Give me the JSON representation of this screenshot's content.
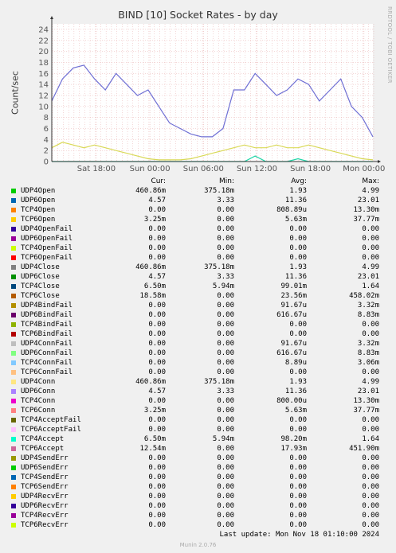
{
  "chart_data": {
    "type": "line",
    "title": "BIND [10] Socket Rates - by day",
    "ylabel": "Count/sec",
    "xlabel": "",
    "ylim": [
      0,
      25
    ],
    "yticks": [
      0,
      2,
      4,
      6,
      8,
      10,
      12,
      14,
      16,
      18,
      20,
      22,
      24
    ],
    "xticks": [
      "Sat 18:00",
      "Sun 00:00",
      "Sun 06:00",
      "Sun 12:00",
      "Sun 18:00",
      "Mon 00:00"
    ],
    "grid": true,
    "x_hours": [
      0,
      1,
      2,
      3,
      4,
      5,
      6,
      7,
      8,
      9,
      10,
      11,
      12,
      13,
      14,
      15,
      16,
      17,
      18,
      19,
      20,
      21,
      22,
      23,
      24,
      25,
      26,
      27,
      28,
      29,
      30
    ],
    "series": [
      {
        "name": "UDP4Open",
        "color": "#6f6fd4",
        "values": [
          11,
          15,
          17,
          17.5,
          15,
          13,
          16,
          14,
          12,
          13,
          10,
          7,
          6,
          5,
          4.5,
          4.5,
          6,
          13,
          13,
          16,
          14,
          12,
          13,
          15,
          14,
          11,
          13,
          15,
          10,
          8,
          4.5
        ]
      },
      {
        "name": "TCP4Open",
        "color": "#d9d957",
        "values": [
          2.5,
          3.5,
          3,
          2.5,
          3,
          2.5,
          2,
          1.5,
          1,
          0.5,
          0.3,
          0.3,
          0.3,
          0.5,
          1,
          1.5,
          2,
          2.5,
          3,
          2.5,
          2.5,
          3,
          2.5,
          2.5,
          3,
          2.5,
          2,
          1.5,
          1,
          0.5,
          0.3
        ]
      },
      {
        "name": "TCP4Accept",
        "color": "#22d6a8",
        "values": [
          0,
          0,
          0,
          0,
          0,
          0,
          0,
          0,
          0,
          0,
          0,
          0,
          0,
          0,
          0,
          0,
          0,
          0,
          0,
          1,
          0,
          0,
          0,
          0.5,
          0,
          0,
          0,
          0,
          0,
          0,
          0
        ]
      }
    ]
  },
  "legend_header": {
    "cur": "Cur:",
    "min": "Min:",
    "avg": "Avg:",
    "max": "Max:"
  },
  "legend": [
    {
      "name": "UDP4Open",
      "color": "#00cc00",
      "cur": "460.86m",
      "min": "375.18m",
      "avg": "1.93",
      "max": "4.99"
    },
    {
      "name": "UDP6Open",
      "color": "#0066b3",
      "cur": "4.57",
      "min": "3.33",
      "avg": "11.36",
      "max": "23.01"
    },
    {
      "name": "TCP4Open",
      "color": "#ff8000",
      "cur": "0.00",
      "min": "0.00",
      "avg": "808.89u",
      "max": "13.30m"
    },
    {
      "name": "TCP6Open",
      "color": "#ffcc00",
      "cur": "3.25m",
      "min": "0.00",
      "avg": "5.63m",
      "max": "37.77m"
    },
    {
      "name": "UDP4OpenFail",
      "color": "#330099",
      "cur": "0.00",
      "min": "0.00",
      "avg": "0.00",
      "max": "0.00"
    },
    {
      "name": "UDP6OpenFail",
      "color": "#990099",
      "cur": "0.00",
      "min": "0.00",
      "avg": "0.00",
      "max": "0.00"
    },
    {
      "name": "TCP4OpenFail",
      "color": "#ccff00",
      "cur": "0.00",
      "min": "0.00",
      "avg": "0.00",
      "max": "0.00"
    },
    {
      "name": "TCP6OpenFail",
      "color": "#ff0000",
      "cur": "0.00",
      "min": "0.00",
      "avg": "0.00",
      "max": "0.00"
    },
    {
      "name": "UDP4Close",
      "color": "#808080",
      "cur": "460.86m",
      "min": "375.18m",
      "avg": "1.93",
      "max": "4.99"
    },
    {
      "name": "UDP6Close",
      "color": "#008f00",
      "cur": "4.57",
      "min": "3.33",
      "avg": "11.36",
      "max": "23.01"
    },
    {
      "name": "TCP4Close",
      "color": "#00487d",
      "cur": "6.50m",
      "min": "5.94m",
      "avg": "99.01m",
      "max": "1.64"
    },
    {
      "name": "TCP6Close",
      "color": "#b35a00",
      "cur": "18.58m",
      "min": "0.00",
      "avg": "23.56m",
      "max": "458.02m"
    },
    {
      "name": "UDP4BindFail",
      "color": "#b38f00",
      "cur": "0.00",
      "min": "0.00",
      "avg": "91.67u",
      "max": "3.32m"
    },
    {
      "name": "UDP6BindFail",
      "color": "#6b006b",
      "cur": "0.00",
      "min": "0.00",
      "avg": "616.67u",
      "max": "8.83m"
    },
    {
      "name": "TCP4BindFail",
      "color": "#8fb300",
      "cur": "0.00",
      "min": "0.00",
      "avg": "0.00",
      "max": "0.00"
    },
    {
      "name": "TCP6BindFail",
      "color": "#b30000",
      "cur": "0.00",
      "min": "0.00",
      "avg": "0.00",
      "max": "0.00"
    },
    {
      "name": "UDP4ConnFail",
      "color": "#bebebe",
      "cur": "0.00",
      "min": "0.00",
      "avg": "91.67u",
      "max": "3.32m"
    },
    {
      "name": "UDP6ConnFail",
      "color": "#80ff80",
      "cur": "0.00",
      "min": "0.00",
      "avg": "616.67u",
      "max": "8.83m"
    },
    {
      "name": "TCP4ConnFail",
      "color": "#80c9ff",
      "cur": "0.00",
      "min": "0.00",
      "avg": "8.89u",
      "max": "3.06m"
    },
    {
      "name": "TCP6ConnFail",
      "color": "#ffc080",
      "cur": "0.00",
      "min": "0.00",
      "avg": "0.00",
      "max": "0.00"
    },
    {
      "name": "UDP4Conn",
      "color": "#ffe680",
      "cur": "460.86m",
      "min": "375.18m",
      "avg": "1.93",
      "max": "4.99"
    },
    {
      "name": "UDP6Conn",
      "color": "#aa80ff",
      "cur": "4.57",
      "min": "3.33",
      "avg": "11.36",
      "max": "23.01"
    },
    {
      "name": "TCP4Conn",
      "color": "#ee00cc",
      "cur": "0.00",
      "min": "0.00",
      "avg": "800.00u",
      "max": "13.30m"
    },
    {
      "name": "TCP6Conn",
      "color": "#ff8080",
      "cur": "3.25m",
      "min": "0.00",
      "avg": "5.63m",
      "max": "37.77m"
    },
    {
      "name": "TCP4AcceptFail",
      "color": "#666600",
      "cur": "0.00",
      "min": "0.00",
      "avg": "0.00",
      "max": "0.00"
    },
    {
      "name": "TCP6AcceptFail",
      "color": "#ffbfff",
      "cur": "0.00",
      "min": "0.00",
      "avg": "0.00",
      "max": "0.00"
    },
    {
      "name": "TCP4Accept",
      "color": "#00ffcc",
      "cur": "6.50m",
      "min": "5.94m",
      "avg": "98.20m",
      "max": "1.64"
    },
    {
      "name": "TCP6Accept",
      "color": "#cc6699",
      "cur": "12.54m",
      "min": "0.00",
      "avg": "17.93m",
      "max": "451.90m"
    },
    {
      "name": "UDP4SendErr",
      "color": "#999900",
      "cur": "0.00",
      "min": "0.00",
      "avg": "0.00",
      "max": "0.00"
    },
    {
      "name": "UDP6SendErr",
      "color": "#00cc00",
      "cur": "0.00",
      "min": "0.00",
      "avg": "0.00",
      "max": "0.00"
    },
    {
      "name": "TCP4SendErr",
      "color": "#0066b3",
      "cur": "0.00",
      "min": "0.00",
      "avg": "0.00",
      "max": "0.00"
    },
    {
      "name": "TCP6SendErr",
      "color": "#ff8000",
      "cur": "0.00",
      "min": "0.00",
      "avg": "0.00",
      "max": "0.00"
    },
    {
      "name": "UDP4RecvErr",
      "color": "#ffcc00",
      "cur": "0.00",
      "min": "0.00",
      "avg": "0.00",
      "max": "0.00"
    },
    {
      "name": "UDP6RecvErr",
      "color": "#330099",
      "cur": "0.00",
      "min": "0.00",
      "avg": "0.00",
      "max": "0.00"
    },
    {
      "name": "TCP4RecvErr",
      "color": "#990099",
      "cur": "0.00",
      "min": "0.00",
      "avg": "0.00",
      "max": "0.00"
    },
    {
      "name": "TCP6RecvErr",
      "color": "#ccff00",
      "cur": "0.00",
      "min": "0.00",
      "avg": "0.00",
      "max": "0.00"
    }
  ],
  "last_update": "Last update: Mon Nov 18 01:10:00 2024",
  "footer": "Munin 2.0.76",
  "side_text": "RRDTOOL / TOBI OETIKER"
}
